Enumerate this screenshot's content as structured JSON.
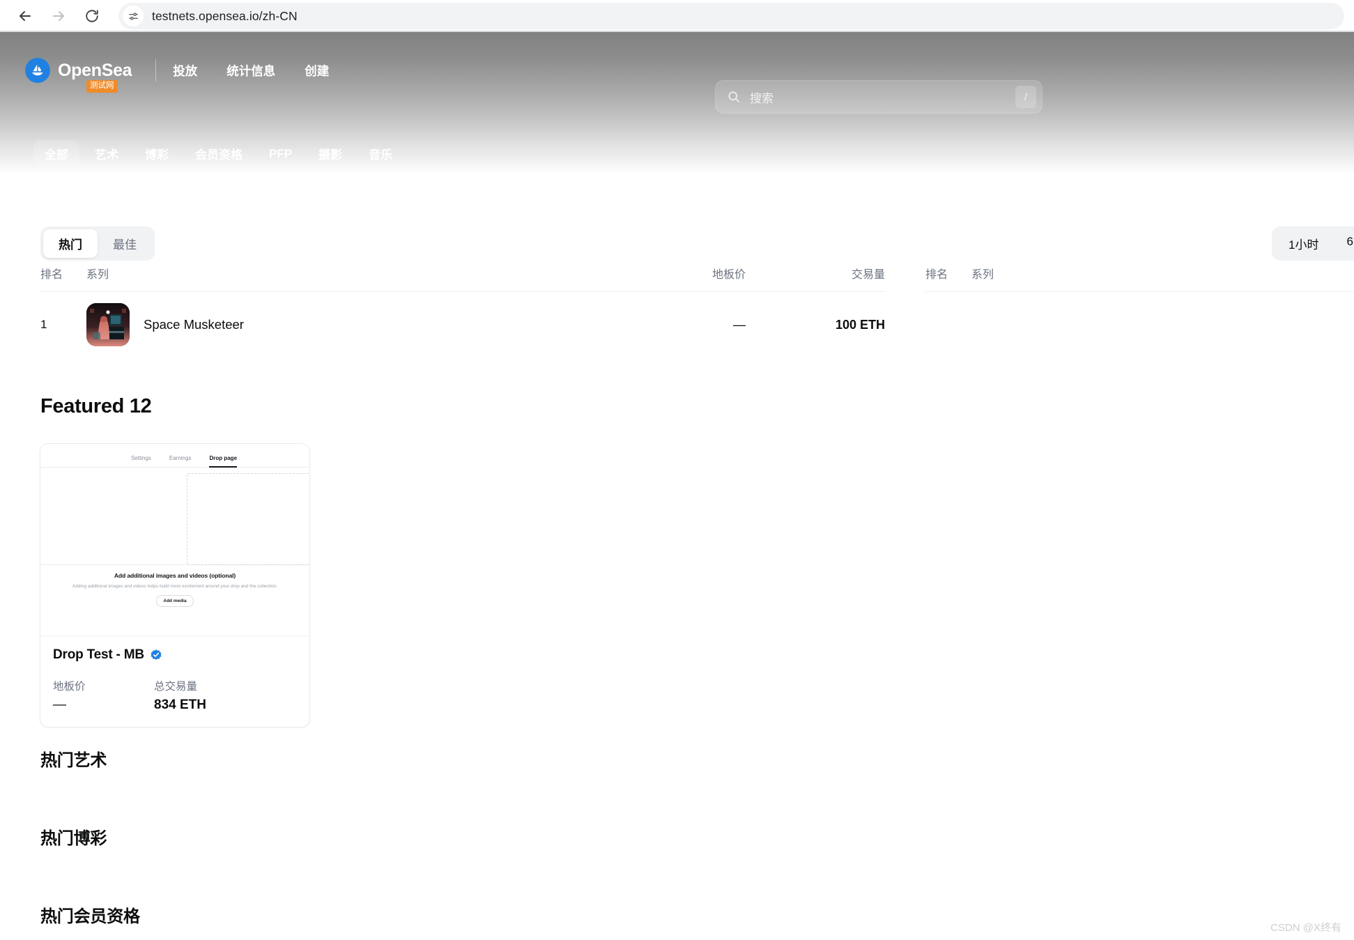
{
  "browser": {
    "url": "testnets.opensea.io/zh-CN",
    "back_label": "后退",
    "forward_label": "前进",
    "reload_label": "重新加载",
    "site_info_label": "查看网站信息"
  },
  "header": {
    "brand_name": "OpenSea",
    "brand_badge": "测试网",
    "nav_links": [
      {
        "label": "投放"
      },
      {
        "label": "统计信息"
      },
      {
        "label": "创建"
      }
    ],
    "search": {
      "placeholder": "搜索",
      "shortcut": "/"
    },
    "category_tabs": [
      {
        "label": "全部",
        "active": true
      },
      {
        "label": "艺术",
        "active": false
      },
      {
        "label": "博彩",
        "active": false
      },
      {
        "label": "会员资格",
        "active": false
      },
      {
        "label": "PFP",
        "active": false
      },
      {
        "label": "摄影",
        "active": false
      },
      {
        "label": "音乐",
        "active": false
      }
    ]
  },
  "rankings": {
    "rank_toggle": [
      {
        "label": "热门",
        "active": true
      },
      {
        "label": "最佳",
        "active": false
      }
    ],
    "time_toggle": [
      {
        "label": "1小时",
        "active": false
      },
      {
        "label": "6",
        "active": false
      }
    ],
    "columns": {
      "rank": "排名",
      "collection": "系列",
      "floor": "地板价",
      "volume": "交易量"
    },
    "left_rows": [
      {
        "rank": "1",
        "name": "Space Musketeer",
        "floor": "—",
        "volume": "100 ETH"
      }
    ],
    "right_rows": []
  },
  "featured": {
    "title": "Featured 12",
    "card": {
      "title": "Drop Test - MB",
      "verified": true,
      "floor_label": "地板价",
      "floor_value": "—",
      "volume_label": "总交易量",
      "volume_value": "834 ETH",
      "preview": {
        "tabs": [
          {
            "label": "Settings",
            "selected": false
          },
          {
            "label": "Earnings",
            "selected": false
          },
          {
            "label": "Drop page",
            "selected": true
          }
        ],
        "heading": "Add additional images and videos (optional)",
        "paragraph": "Adding additional images and videos helps build more excitement around your drop and the collection.",
        "button": "Add media"
      }
    }
  },
  "sections": [
    {
      "label": "热门艺术"
    },
    {
      "label": "热门博彩"
    },
    {
      "label": "热门会员资格"
    }
  ],
  "watermark": "CSDN @X终有",
  "colors": {
    "brand_blue": "#2081e2",
    "badge_orange": "#ef8c2a",
    "verified_blue": "#2081e2",
    "text_primary": "#0c0d0e",
    "text_muted": "#6b7280"
  }
}
